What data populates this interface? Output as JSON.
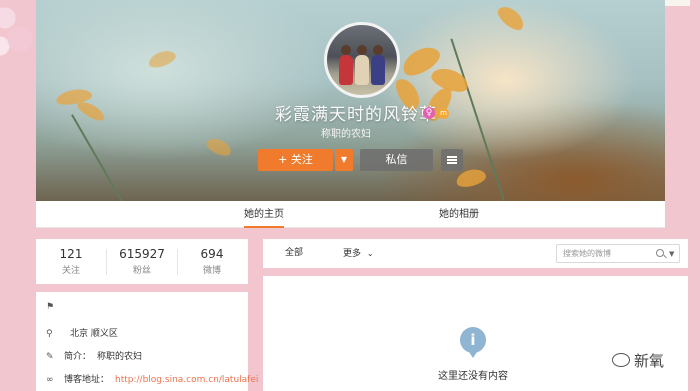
{
  "profile": {
    "nickname": "彩霞满天时的风铃草",
    "gender_badge": "♀",
    "level_badge": "m",
    "bio": "称职的农妇",
    "follow_label": "+ 关注",
    "follow_more_icon": "▼",
    "message_label": "私信"
  },
  "tabs": [
    {
      "label": "她的主页",
      "active": true
    },
    {
      "label": "她的相册",
      "active": false
    }
  ],
  "stats": [
    {
      "value": "121",
      "label": "关注"
    },
    {
      "value": "615927",
      "label": "粉丝"
    },
    {
      "value": "694",
      "label": "微博"
    }
  ],
  "info": {
    "location": "北京 顺义区",
    "intro_label": "简介：",
    "intro_value": "称职的农妇",
    "blog_label": "博客地址：",
    "blog_url": "http://blog.sina.com.cn/latulafei"
  },
  "feed": {
    "all_label": "全部",
    "more_label": "更多",
    "search_placeholder": "搜索她的微博",
    "empty_text": "这里还没有内容"
  },
  "watermark": "新氧",
  "colors": {
    "page_bg": "#f2c6cf",
    "accent": "#f07b2c",
    "link": "#eb7350",
    "info_icon": "#8fb5d2"
  }
}
